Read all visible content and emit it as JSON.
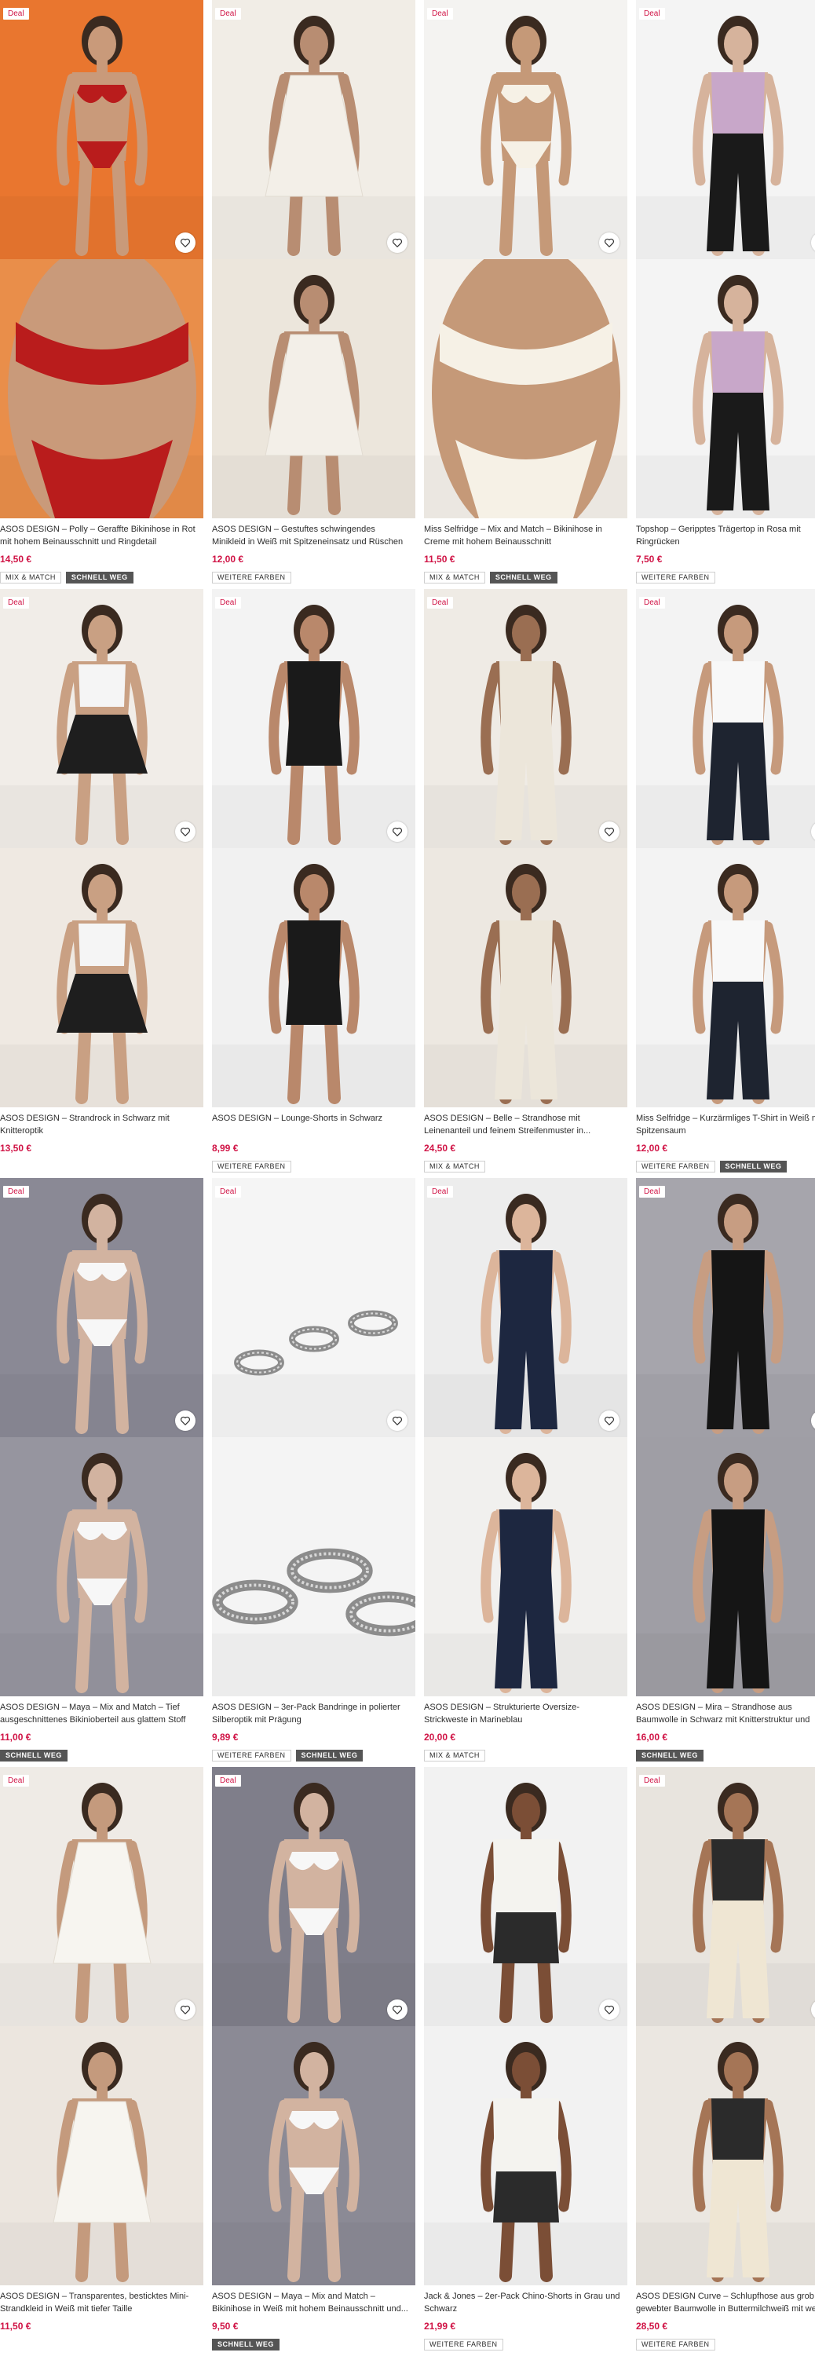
{
  "products": [
    {
      "title": "ASOS DESIGN – Polly – Geraffte Bikinihose in Rot mit hohem Beinausschnitt und Ringdetail",
      "price": "14,50 €",
      "deal": "Deal",
      "badges": [
        "MIX & MATCH",
        "SCHNELL WEG"
      ],
      "bg": [
        "#e9762f",
        "#e98e4a"
      ],
      "garment": "#b91c1c",
      "skin": "#c99a7a"
    },
    {
      "title": "ASOS DESIGN – Gestuftes schwingendes Minikleid in Weiß mit Spitzeneinsatz und Rüschen",
      "price": "12,00 €",
      "deal": "Deal",
      "badges": [
        "WEITERE FARBEN"
      ],
      "bg": [
        "#f1ede6",
        "#ece6dc"
      ],
      "garment": "#f3efe8",
      "skin": "#b88d72"
    },
    {
      "title": "Miss Selfridge – Mix and Match – Bikinihose in Creme mit hohem Beinausschnitt",
      "price": "11,50 €",
      "deal": "Deal",
      "badges": [
        "MIX & MATCH",
        "SCHNELL WEG"
      ],
      "bg": [
        "#f4f3f1",
        "#f3efe9"
      ],
      "garment": "#f6f1e6",
      "skin": "#c59978"
    },
    {
      "title": "Topshop – Geripptes Trägertop in Rosa mit Ringrücken",
      "price": "7,50 €",
      "deal": "Deal",
      "badges": [
        "WEITERE FARBEN"
      ],
      "bg": [
        "#f4f4f4",
        "#f4f4f4"
      ],
      "garment": "#c8a7c9",
      "skin": "#d6b39c"
    },
    {
      "title": "ASOS DESIGN – Strandrock in Schwarz mit Knitteroptik",
      "price": "13,50 €",
      "deal": "Deal",
      "badges": [],
      "bg": [
        "#f1ede8",
        "#efe9e2"
      ],
      "garment": "#1e1e1e",
      "skin": "#c9a083"
    },
    {
      "title": "ASOS DESIGN – Lounge-Shorts in Schwarz",
      "price": "8,99 €",
      "deal": "Deal",
      "badges": [
        "WEITERE FARBEN"
      ],
      "bg": [
        "#f3f3f3",
        "#f1f1f1"
      ],
      "garment": "#1a1a1a",
      "skin": "#b9886b"
    },
    {
      "title": "ASOS DESIGN – Belle – Strandhose mit Leinenanteil und feinem Streifenmuster in...",
      "price": "24,50 €",
      "deal": "Deal",
      "badges": [
        "MIX & MATCH"
      ],
      "bg": [
        "#efebe5",
        "#ede8e1"
      ],
      "garment": "#ece6da",
      "skin": "#9a6e52"
    },
    {
      "title": "Miss Selfridge – Kurzärmliges T-Shirt in Weiß mit Spitzensaum",
      "price": "12,00 €",
      "deal": "Deal",
      "badges": [
        "WEITERE FARBEN",
        "SCHNELL WEG"
      ],
      "bg": [
        "#f3f3f3",
        "#f3f3f3"
      ],
      "garment": "#f8f8f8",
      "skin": "#c69a7c"
    },
    {
      "title": "ASOS DESIGN – Maya – Mix and Match – Tief ausgeschnittenes Bikinioberteil aus glattem Stoff in...",
      "price": "11,00 €",
      "deal": "Deal",
      "badges": [
        "SCHNELL WEG"
      ],
      "bg": [
        "#8a8995",
        "#96959f"
      ],
      "garment": "#f7f7f7",
      "skin": "#d2b3a0"
    },
    {
      "title": "ASOS DESIGN – 3er-Pack Bandringe in polierter Silberoptik mit Prägung",
      "price": "9,89 €",
      "deal": "Deal",
      "badges": [
        "WEITERE FARBEN",
        "SCHNELL WEG"
      ],
      "bg": [
        "#f5f5f5",
        "#f4f4f4"
      ],
      "garment": "#a9a9a9",
      "skin": "#f5f5f5"
    },
    {
      "title": "ASOS DESIGN – Strukturierte Oversize-Strickweste in Marineblau",
      "price": "20,00 €",
      "deal": "Deal",
      "badges": [
        "MIX & MATCH"
      ],
      "bg": [
        "#ededed",
        "#f1f0ee"
      ],
      "garment": "#1d2740",
      "skin": "#dcb59b"
    },
    {
      "title": "ASOS DESIGN – Mira – Strandhose aus Baumwolle in Schwarz mit Knitterstruktur und weitem Bein",
      "price": "16,00 €",
      "deal": "Deal",
      "badges": [
        "SCHNELL WEG"
      ],
      "bg": [
        "#a6a5ac",
        "#9f9ea5"
      ],
      "garment": "#151515",
      "skin": "#c79d82"
    },
    {
      "title": "ASOS DESIGN – Transparentes, besticktes Mini-Strandkleid in Weiß mit tiefer Taille",
      "price": "11,50 €",
      "deal": "Deal",
      "badges": [],
      "bg": [
        "#efebe6",
        "#ece6df"
      ],
      "garment": "#f7f5f0",
      "skin": "#c49a7d"
    },
    {
      "title": "ASOS DESIGN – Maya – Mix and Match – Bikinihose in Weiß mit hohem Beinausschnitt und...",
      "price": "9,50 €",
      "deal": "Deal",
      "badges": [
        "SCHNELL WEG"
      ],
      "bg": [
        "#7f7e8a",
        "#8b8a95"
      ],
      "garment": "#f7f7f7",
      "skin": "#d2b3a0"
    },
    {
      "title": "Jack & Jones – 2er-Pack Chino-Shorts in Grau und Schwarz",
      "price": "21,99 €",
      "deal": "",
      "badges": [
        "WEITERE FARBEN"
      ],
      "bg": [
        "#f2f2f2",
        "#f2f2f2"
      ],
      "garment": "#2b2b2b",
      "skin": "#7b4e36"
    },
    {
      "title": "ASOS DESIGN Curve – Schlupfhose aus grob gewebter Baumwolle in Buttermilchweiß mit weitem Bein",
      "price": "28,50 €",
      "deal": "Deal",
      "badges": [
        "WEITERE FARBEN"
      ],
      "bg": [
        "#e8e4de",
        "#ebe7e1"
      ],
      "garment": "#efe6d3",
      "skin": "#a57556"
    }
  ],
  "colors": {
    "price": "#d01345",
    "deal_text": "#d01345",
    "badge_dark": "#555555"
  }
}
